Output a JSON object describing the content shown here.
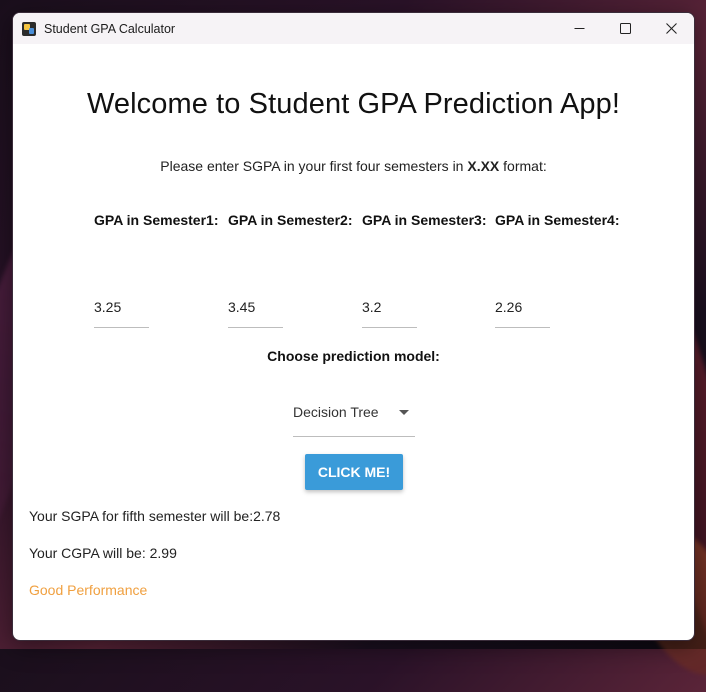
{
  "window": {
    "title": "Student GPA Calculator"
  },
  "heading": "Welcome to Student GPA Prediction App!",
  "instruction": {
    "prefix": "Please enter SGPA in your first four semesters in ",
    "format": "X.XX",
    "suffix": " format:"
  },
  "semesters": [
    {
      "label": "GPA in Semester1:",
      "value": "3.25"
    },
    {
      "label": "GPA in Semester2:",
      "value": "3.45"
    },
    {
      "label": "GPA in Semester3:",
      "value": "3.2"
    },
    {
      "label": "GPA in Semester4:",
      "value": "2.26"
    }
  ],
  "model": {
    "label": "Choose prediction model:",
    "selected": "Decision Tree"
  },
  "button": {
    "label": "CLICK ME!",
    "color": "#3a9bd9"
  },
  "results": {
    "sgpa": "Your SGPA for fifth semester will be:2.78",
    "cgpa": "Your CGPA will be: 2.99",
    "performance": "Good Performance",
    "performance_color": "#f0a040"
  },
  "icons": {
    "app": "app-icon",
    "minimize": "minimize-icon",
    "maximize": "maximize-icon",
    "close": "close-icon",
    "dropdown": "chevron-down-icon"
  }
}
